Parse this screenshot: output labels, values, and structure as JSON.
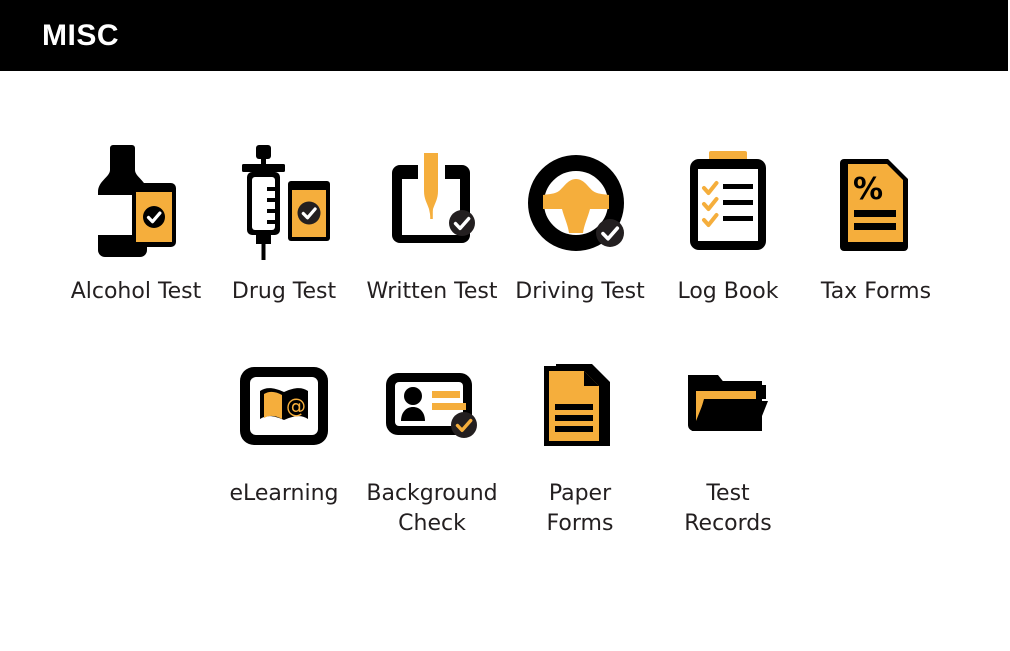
{
  "header": {
    "title": "MISC",
    "background_color": "#000000",
    "text_color": "#FFFFFF"
  },
  "theme": {
    "accent_orange": "#F5AE3C",
    "ink_black": "#000000",
    "label_color": "#231F20",
    "page_background": "#FFFFFF"
  },
  "grid": {
    "rows": [
      {
        "row_name": "row-1",
        "items": [
          {
            "label": "Alcohol Test",
            "icon": "alcohol-bottle-test-icon"
          },
          {
            "label": "Drug Test",
            "icon": "syringe-test-icon"
          },
          {
            "label": "Written Test",
            "icon": "pen-paper-test-icon"
          },
          {
            "label": "Driving Test",
            "icon": "steering-wheel-test-icon"
          },
          {
            "label": "Log Book",
            "icon": "clipboard-checklist-icon"
          },
          {
            "label": "Tax Forms",
            "icon": "percent-document-icon"
          }
        ]
      },
      {
        "row_name": "row-2",
        "items": [
          {
            "label": "eLearning",
            "icon": "monitor-book-at-icon"
          },
          {
            "label": "Background\nCheck",
            "icon": "id-card-check-icon"
          },
          {
            "label": "Paper\nForms",
            "icon": "stacked-documents-icon"
          },
          {
            "label": "Test\nRecords",
            "icon": "open-folder-icon"
          }
        ]
      }
    ]
  }
}
